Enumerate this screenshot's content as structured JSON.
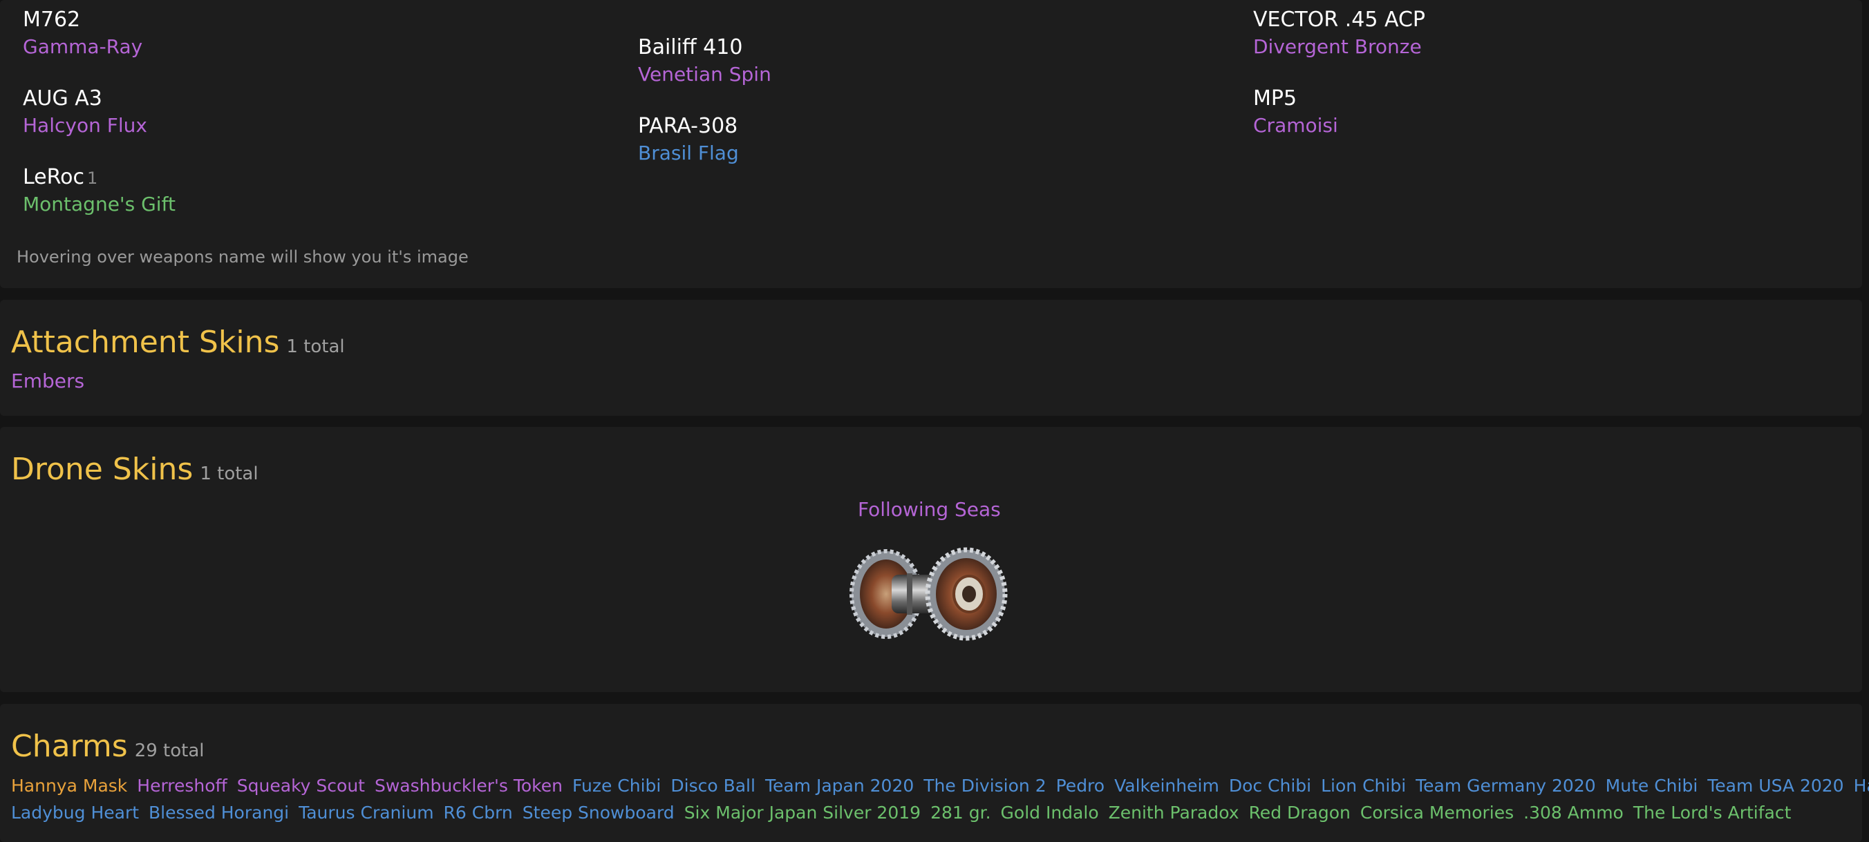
{
  "weapons_panel": {
    "columns": [
      [
        {
          "name": "M762",
          "count": "",
          "skin": "Gamma-Ray",
          "skin_color": "#b565d6"
        },
        {
          "name": "AUG A3",
          "count": "",
          "skin": "Halcyon Flux",
          "skin_color": "#b565d6"
        },
        {
          "name": "LeRoc",
          "count": "1",
          "skin": "Montagne's Gift",
          "skin_color": "#6cc06c"
        }
      ],
      [
        {
          "name": "Bailiff 410",
          "count": "",
          "skin": "Venetian Spin",
          "skin_color": "#b565d6"
        },
        {
          "name": "PARA-308",
          "count": "",
          "skin": "Brasil Flag",
          "skin_color": "#4f8fd6"
        }
      ],
      [
        {
          "name": "VECTOR .45 ACP",
          "count": "",
          "skin": "Divergent Bronze",
          "skin_color": "#b565d6"
        },
        {
          "name": "MP5",
          "count": "",
          "skin": "Cramoisi",
          "skin_color": "#b565d6"
        }
      ]
    ],
    "hint": "Hovering over weapons name will show you it's image"
  },
  "attachment_skins": {
    "title": "Attachment Skins",
    "count": "1 total",
    "items": [
      {
        "label": "Embers",
        "color": "#b565d6"
      }
    ]
  },
  "drone_skins": {
    "title": "Drone Skins",
    "count": "1 total",
    "items": [
      {
        "label": "Following Seas",
        "color": "#b565d6",
        "icon": "drone-wheels-image"
      }
    ]
  },
  "charms": {
    "title": "Charms",
    "count": "29 total",
    "rows": [
      [
        {
          "label": "Hannya Mask",
          "color": "#e9a23b"
        },
        {
          "label": "Herreshoff",
          "color": "#b565d6"
        },
        {
          "label": "Squeaky Scout",
          "color": "#b565d6"
        },
        {
          "label": "Swashbuckler's Token",
          "color": "#b565d6"
        },
        {
          "label": "Fuze Chibi",
          "color": "#4f8fd6"
        },
        {
          "label": "Disco Ball",
          "color": "#4f8fd6"
        },
        {
          "label": "Team Japan 2020",
          "color": "#4f8fd6"
        },
        {
          "label": "The Division 2",
          "color": "#4f8fd6"
        },
        {
          "label": "Pedro",
          "color": "#4f8fd6"
        },
        {
          "label": "Valkeinheim",
          "color": "#4f8fd6"
        },
        {
          "label": "Doc Chibi",
          "color": "#4f8fd6"
        },
        {
          "label": "Lion Chibi",
          "color": "#4f8fd6"
        },
        {
          "label": "Team Germany 2020",
          "color": "#4f8fd6"
        },
        {
          "label": "Mute Chibi",
          "color": "#4f8fd6"
        },
        {
          "label": "Team USA 2020",
          "color": "#4f8fd6"
        },
        {
          "label": "Happy Sam",
          "color": "#4f8fd6"
        }
      ],
      [
        {
          "label": "Ladybug Heart",
          "color": "#4f8fd6"
        },
        {
          "label": "Blessed Horangi",
          "color": "#4f8fd6"
        },
        {
          "label": "Taurus Cranium",
          "color": "#4f8fd6"
        },
        {
          "label": "R6 Cbrn",
          "color": "#4f8fd6"
        },
        {
          "label": "Steep Snowboard",
          "color": "#4f8fd6"
        },
        {
          "label": "Six Major Japan Silver 2019",
          "color": "#6cc06c"
        },
        {
          "label": "281 gr.",
          "color": "#6cc06c"
        },
        {
          "label": "Gold Indalo",
          "color": "#6cc06c"
        },
        {
          "label": "Zenith Paradox",
          "color": "#6cc06c"
        },
        {
          "label": "Red Dragon",
          "color": "#6cc06c"
        },
        {
          "label": "Corsica Memories",
          "color": "#6cc06c"
        },
        {
          "label": ".308 Ammo",
          "color": "#6cc06c"
        },
        {
          "label": "The Lord's Artifact",
          "color": "#6cc06c"
        }
      ]
    ]
  }
}
